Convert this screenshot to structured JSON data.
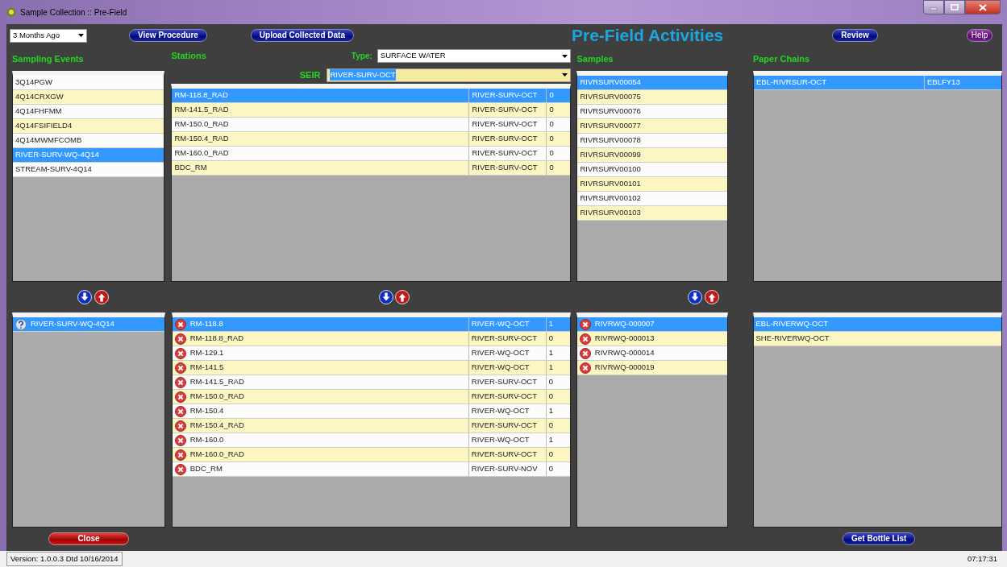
{
  "window": {
    "title": "Sample Collection :: Pre-Field"
  },
  "toolbar": {
    "period": "3 Months Ago",
    "buttons": [
      {
        "label": "View Procedure"
      },
      {
        "label": "Upload Collected Data"
      }
    ],
    "heading": "Pre-Field Activities",
    "review": "Review",
    "help": "Help"
  },
  "sampling_events": {
    "title": "Sampling Events",
    "items": [
      {
        "label": "3Q14PGW",
        "selected": false
      },
      {
        "label": "4Q14CRXGW",
        "selected": false
      },
      {
        "label": "4Q14FHFMM",
        "selected": false
      },
      {
        "label": "4Q14FSIFIELD4",
        "selected": false
      },
      {
        "label": "4Q14MWMFCOMB",
        "selected": false
      },
      {
        "label": "RIVER-SURV-WQ-4Q14",
        "selected": true
      },
      {
        "label": "STREAM-SURV-4Q14",
        "selected": false
      }
    ]
  },
  "stations": {
    "title": "Stations",
    "type_label": "Type:",
    "type": "SURFACE WATER",
    "seir_label": "SEIR",
    "seir": "RIVER-SURV-OCT",
    "rows": [
      {
        "name": "RM-118.8_RAD",
        "seir": "RIVER-SURV-OCT",
        "count": "0",
        "selected": true
      },
      {
        "name": "RM-141.5_RAD",
        "seir": "RIVER-SURV-OCT",
        "count": "0",
        "selected": false
      },
      {
        "name": "RM-150.0_RAD",
        "seir": "RIVER-SURV-OCT",
        "count": "0",
        "selected": false
      },
      {
        "name": "RM-150.4_RAD",
        "seir": "RIVER-SURV-OCT",
        "count": "0",
        "selected": false
      },
      {
        "name": "RM-160.0_RAD",
        "seir": "RIVER-SURV-OCT",
        "count": "0",
        "selected": false
      },
      {
        "name": "BDC_RM",
        "seir": "RIVER-SURV-OCT",
        "count": "0",
        "selected": false
      }
    ]
  },
  "samples": {
    "title": "Samples",
    "items": [
      {
        "label": "RIVRSURV00054",
        "selected": true
      },
      {
        "label": "RIVRSURV00075",
        "selected": false
      },
      {
        "label": "RIVRSURV00076",
        "selected": false
      },
      {
        "label": "RIVRSURV00077",
        "selected": false
      },
      {
        "label": "RIVRSURV00078",
        "selected": false
      },
      {
        "label": "RIVRSURV00099",
        "selected": false
      },
      {
        "label": "RIVRSURV00100",
        "selected": false
      },
      {
        "label": "RIVRSURV00101",
        "selected": false
      },
      {
        "label": "RIVRSURV00102",
        "selected": false
      },
      {
        "label": "RIVRSURV00103",
        "selected": false
      }
    ]
  },
  "paper_chains": {
    "title": "Paper Chains",
    "rows": [
      {
        "name": "EBL-RIVRSUR-OCT",
        "code": "EBLFY13",
        "selected": true
      }
    ]
  },
  "assigned_events": [
    {
      "label": "RIVER-SURV-WQ-4Q14",
      "selected": true
    }
  ],
  "assigned_stations": [
    {
      "name": "RM-118.8",
      "seir": "RIVER-WQ-OCT",
      "count": "1",
      "selected": true
    },
    {
      "name": "RM-118.8_RAD",
      "seir": "RIVER-SURV-OCT",
      "count": "0",
      "selected": false
    },
    {
      "name": "RM-129.1",
      "seir": "RIVER-WQ-OCT",
      "count": "1",
      "selected": false
    },
    {
      "name": "RM-141.5",
      "seir": "RIVER-WQ-OCT",
      "count": "1",
      "selected": false
    },
    {
      "name": "RM-141.5_RAD",
      "seir": "RIVER-SURV-OCT",
      "count": "0",
      "selected": false
    },
    {
      "name": "RM-150.0_RAD",
      "seir": "RIVER-SURV-OCT",
      "count": "0",
      "selected": false
    },
    {
      "name": "RM-150.4",
      "seir": "RIVER-WQ-OCT",
      "count": "1",
      "selected": false
    },
    {
      "name": "RM-150.4_RAD",
      "seir": "RIVER-SURV-OCT",
      "count": "0",
      "selected": false
    },
    {
      "name": "RM-160.0",
      "seir": "RIVER-WQ-OCT",
      "count": "1",
      "selected": false
    },
    {
      "name": "RM-160.0_RAD",
      "seir": "RIVER-SURV-OCT",
      "count": "0",
      "selected": false
    },
    {
      "name": "BDC_RM",
      "seir": "RIVER-SURV-NOV",
      "count": "0",
      "selected": false
    }
  ],
  "assigned_samples": [
    {
      "label": "RIVRWQ-000007",
      "selected": true
    },
    {
      "label": "RIVRWQ-000013",
      "selected": false
    },
    {
      "label": "RIVRWQ-000014",
      "selected": false
    },
    {
      "label": "RIVRWQ-000019",
      "selected": false
    }
  ],
  "assigned_chains": [
    {
      "label": "EBL-RIVERWQ-OCT",
      "selected": true
    },
    {
      "label": "SHE-RIVERWQ-OCT",
      "selected": false
    }
  ],
  "footer": {
    "close": "Close",
    "bottle": "Get Bottle List"
  },
  "status_bar": {
    "version": "Version: 1.0.0.3 Dtd 10/16/2014",
    "time": "07:17:31"
  }
}
